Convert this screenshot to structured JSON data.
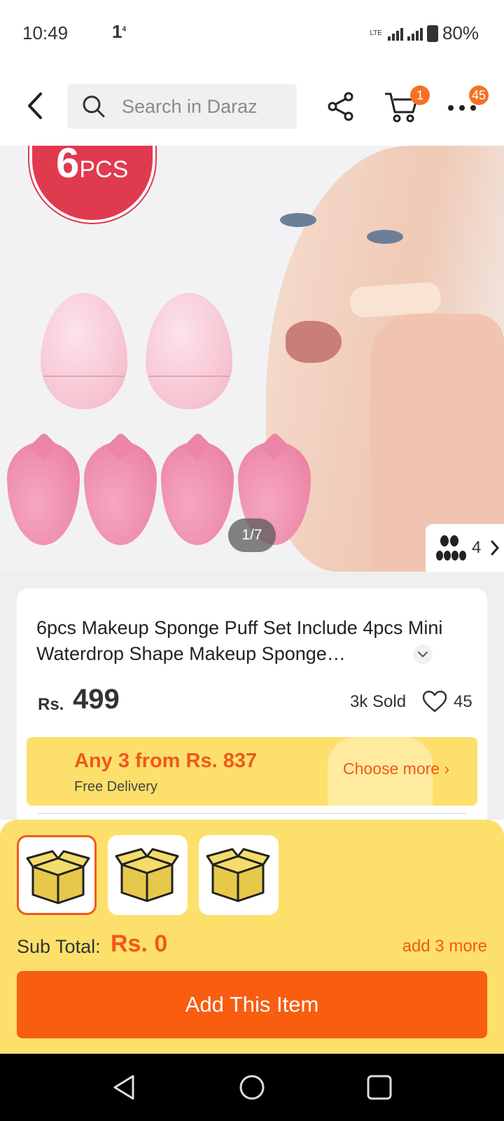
{
  "status_bar": {
    "time": "10:49",
    "notification": "1",
    "battery": "80%",
    "network": "LTE"
  },
  "header": {
    "search_placeholder": "Search in Daraz",
    "cart_badge": "1",
    "more_badge": "45"
  },
  "gallery": {
    "promo_number": "6",
    "promo_unit": "PCS",
    "page_indicator": "1/7",
    "variant_count": "4"
  },
  "product": {
    "title": "6pcs Makeup Sponge Puff Set Include 4pcs Mini Waterdrop Shape Makeup Sponge…",
    "currency": "Rs.",
    "price": "499",
    "sold": "3k Sold",
    "wishlist_count": "45"
  },
  "promo": {
    "title": "Any 3 from Rs. 837",
    "subtitle": "Free Delivery",
    "choose_more": "Choose more"
  },
  "bundle_sheet": {
    "slots": [
      {
        "selected": true
      },
      {
        "selected": false
      },
      {
        "selected": false
      }
    ],
    "subtotal_label": "Sub Total:",
    "subtotal_value": "Rs. 0",
    "add_more": "add 3 more",
    "add_button": "Add This Item"
  },
  "colors": {
    "accent": "#f85d10",
    "promo_bg": "#fde06b",
    "badge": "#f57224"
  }
}
